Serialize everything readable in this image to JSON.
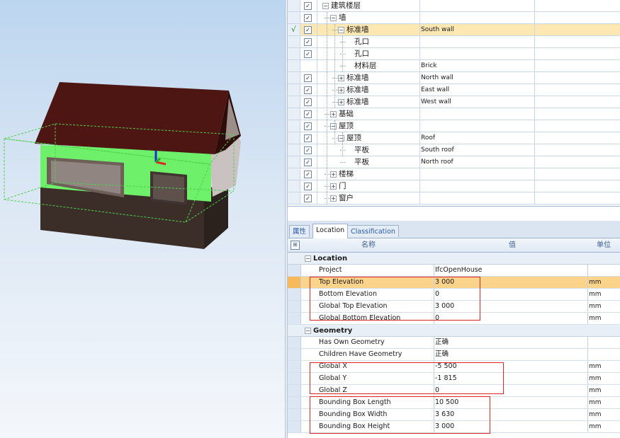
{
  "tree": {
    "rows": [
      {
        "check": "",
        "checked": true,
        "indent": 0,
        "expander": "minus",
        "name": "建筑楼层",
        "value": "",
        "selected": false
      },
      {
        "check": "",
        "checked": true,
        "indent": 1,
        "expander": "minus",
        "name": "墙",
        "value": "",
        "selected": false
      },
      {
        "check": "√",
        "checked": true,
        "indent": 2,
        "expander": "minus",
        "name": "标准墙",
        "value": "South wall",
        "selected": true
      },
      {
        "check": "",
        "checked": true,
        "indent": 3,
        "expander": "",
        "name": "孔口",
        "value": "",
        "selected": false
      },
      {
        "check": "",
        "checked": true,
        "indent": 3,
        "expander": "",
        "name": "孔口",
        "value": "",
        "selected": false
      },
      {
        "check": "",
        "checked": false,
        "indent": 3,
        "expander": "",
        "name": "材料层",
        "value": "Brick",
        "selected": false
      },
      {
        "check": "",
        "checked": true,
        "indent": 2,
        "expander": "plus",
        "name": "标准墙",
        "value": "North wall",
        "selected": false
      },
      {
        "check": "",
        "checked": true,
        "indent": 2,
        "expander": "plus",
        "name": "标准墙",
        "value": "East wall",
        "selected": false
      },
      {
        "check": "",
        "checked": true,
        "indent": 2,
        "expander": "plus",
        "name": "标准墙",
        "value": "West wall",
        "selected": false
      },
      {
        "check": "",
        "checked": true,
        "indent": 1,
        "expander": "plus",
        "name": "基础",
        "value": "",
        "selected": false
      },
      {
        "check": "",
        "checked": true,
        "indent": 1,
        "expander": "minus",
        "name": "屋顶",
        "value": "",
        "selected": false
      },
      {
        "check": "",
        "checked": true,
        "indent": 2,
        "expander": "minus",
        "name": "屋顶",
        "value": "Roof",
        "selected": false
      },
      {
        "check": "",
        "checked": true,
        "indent": 3,
        "expander": "",
        "name": "平板",
        "value": "South roof",
        "selected": false
      },
      {
        "check": "",
        "checked": true,
        "indent": 3,
        "expander": "",
        "name": "平板",
        "value": "North roof",
        "selected": false
      },
      {
        "check": "",
        "checked": true,
        "indent": 1,
        "expander": "plus",
        "name": "楼梯",
        "value": "",
        "selected": false
      },
      {
        "check": "",
        "checked": true,
        "indent": 1,
        "expander": "plus",
        "name": "门",
        "value": "",
        "selected": false
      },
      {
        "check": "",
        "checked": true,
        "indent": 1,
        "expander": "plus",
        "name": "窗户",
        "value": "",
        "selected": false
      }
    ]
  },
  "tabs": [
    {
      "label": "属性",
      "active": false
    },
    {
      "label": "Location",
      "active": true
    },
    {
      "label": "Classification",
      "active": false
    }
  ],
  "properties": {
    "header": {
      "name": "名称",
      "value": "值",
      "unit": "单位"
    },
    "categories": [
      {
        "label": "Location",
        "rows": [
          {
            "name": "Project",
            "value": "IfcOpenHouse",
            "unit": "",
            "selected": false
          },
          {
            "name": "Top Elevation",
            "value": "3 000",
            "unit": "mm",
            "selected": true
          },
          {
            "name": "Bottom Elevation",
            "value": "0",
            "unit": "mm",
            "selected": false
          },
          {
            "name": "Global Top Elevation",
            "value": "3 000",
            "unit": "mm",
            "selected": false
          },
          {
            "name": "Global Bottom Elevation",
            "value": "0",
            "unit": "mm",
            "selected": false
          }
        ]
      },
      {
        "label": "Geometry",
        "rows": [
          {
            "name": "Has Own Geometry",
            "value": "正确",
            "unit": "",
            "selected": false
          },
          {
            "name": "Children Have Geometry",
            "value": "正确",
            "unit": "",
            "selected": false
          },
          {
            "name": "Global X",
            "value": "-5 500",
            "unit": "mm",
            "selected": false
          },
          {
            "name": "Global Y",
            "value": "-1 815",
            "unit": "mm",
            "selected": false
          },
          {
            "name": "Global Z",
            "value": "0",
            "unit": "mm",
            "selected": false
          },
          {
            "name": "Bounding Box Length",
            "value": "10 500",
            "unit": "mm",
            "selected": false
          },
          {
            "name": "Bounding Box Width",
            "value": "3 630",
            "unit": "mm",
            "selected": false
          },
          {
            "name": "Bounding Box Height",
            "value": "3 000",
            "unit": "mm",
            "selected": false
          }
        ]
      }
    ]
  },
  "colors": {
    "selection_row": "#fde7b3",
    "highlight_box": "#e02424",
    "wall_highlight": "#69ea6a",
    "roof": "#4a1410",
    "foundation": "#3a2c26"
  },
  "icons": {
    "settings": "grid-settings-icon",
    "expand": "expand-icon",
    "collapse": "collapse-icon",
    "checkbox": "checkbox-icon"
  }
}
